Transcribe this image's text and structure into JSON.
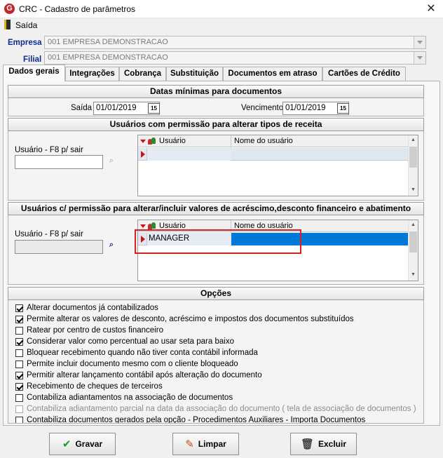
{
  "window": {
    "title": "CRC - Cadastro de parâmetros",
    "app_icon_letter": "G",
    "close_glyph": "✕"
  },
  "menu": {
    "exit_label": "Saída"
  },
  "company": {
    "label": "Empresa",
    "value": "001 EMPRESA DEMONSTRACAO"
  },
  "branch": {
    "label": "Filial",
    "value": "001 EMPRESA DEMONSTRACAO"
  },
  "tabs": [
    {
      "label": "Dados gerais"
    },
    {
      "label": "Integrações"
    },
    {
      "label": "Cobrança"
    },
    {
      "label": "Substituição"
    },
    {
      "label": "Documentos em atraso"
    },
    {
      "label": "Cartões de Crédito"
    }
  ],
  "min_dates": {
    "header": "Datas mínimas para documentos",
    "exit_label": "Saída",
    "exit_value": "01/01/2019",
    "due_label": "Vencimento",
    "due_value": "01/01/2019",
    "calendar_glyph": "15"
  },
  "revenue_users": {
    "header": "Usuários com permissão para alterar tipos de receita",
    "input_label": "Usuário - F8 p/ sair",
    "input_value": "",
    "columns": [
      "Usuário",
      "Nome do usuário"
    ],
    "rows": [
      {
        "user": "",
        "name": ""
      }
    ]
  },
  "discount_users": {
    "header": "Usuários c/ permissão para alterar/incluir valores de acréscimo,desconto financeiro e abatimento",
    "input_label": "Usuário - F8 p/ sair",
    "input_value": "",
    "columns": [
      "Usuário",
      "Nome do usuário"
    ],
    "rows": [
      {
        "user": "MANAGER",
        "name": ""
      }
    ]
  },
  "options": {
    "header": "Opções",
    "items": [
      {
        "label": "Alterar documentos já contabilizados",
        "checked": true,
        "enabled": true
      },
      {
        "label": "Permite alterar os valores de desconto, acréscimo  e impostos dos documentos substituídos",
        "checked": true,
        "enabled": true
      },
      {
        "label": "Ratear por centro de custos financeiro",
        "checked": false,
        "enabled": true
      },
      {
        "label": "Considerar valor como percentual ao usar seta para baixo",
        "checked": true,
        "enabled": true
      },
      {
        "label": "Bloquear recebimento quando não tiver conta contábil informada",
        "checked": false,
        "enabled": true
      },
      {
        "label": "Permite incluir documento mesmo com o cliente bloqueado",
        "checked": false,
        "enabled": true
      },
      {
        "label": "Permitir alterar lançamento contábil após alteração do documento",
        "checked": true,
        "enabled": true
      },
      {
        "label": "Recebimento de cheques de terceiros",
        "checked": true,
        "enabled": true
      },
      {
        "label": "Contabiliza adiantamentos na associação de documentos",
        "checked": false,
        "enabled": true
      },
      {
        "label": "Contabiliza adiantamento parcial na data da associação do documento ( tela de associação de documentos )",
        "checked": false,
        "enabled": false
      },
      {
        "label": "Contabiliza documentos gerados pela opção - Procedimentos Auxiliares - Importa Documentos",
        "checked": false,
        "enabled": true
      }
    ]
  },
  "buttons": {
    "save": {
      "label": "Gravar",
      "icon": "checkmark-icon"
    },
    "clear": {
      "label": "Limpar",
      "icon": "broom-icon"
    },
    "delete": {
      "label": "Excluir",
      "icon": "trash-icon"
    }
  },
  "colors": {
    "selection": "#0078d7",
    "highlight_box": "#d92020",
    "label_blue": "#0b2e8a"
  }
}
